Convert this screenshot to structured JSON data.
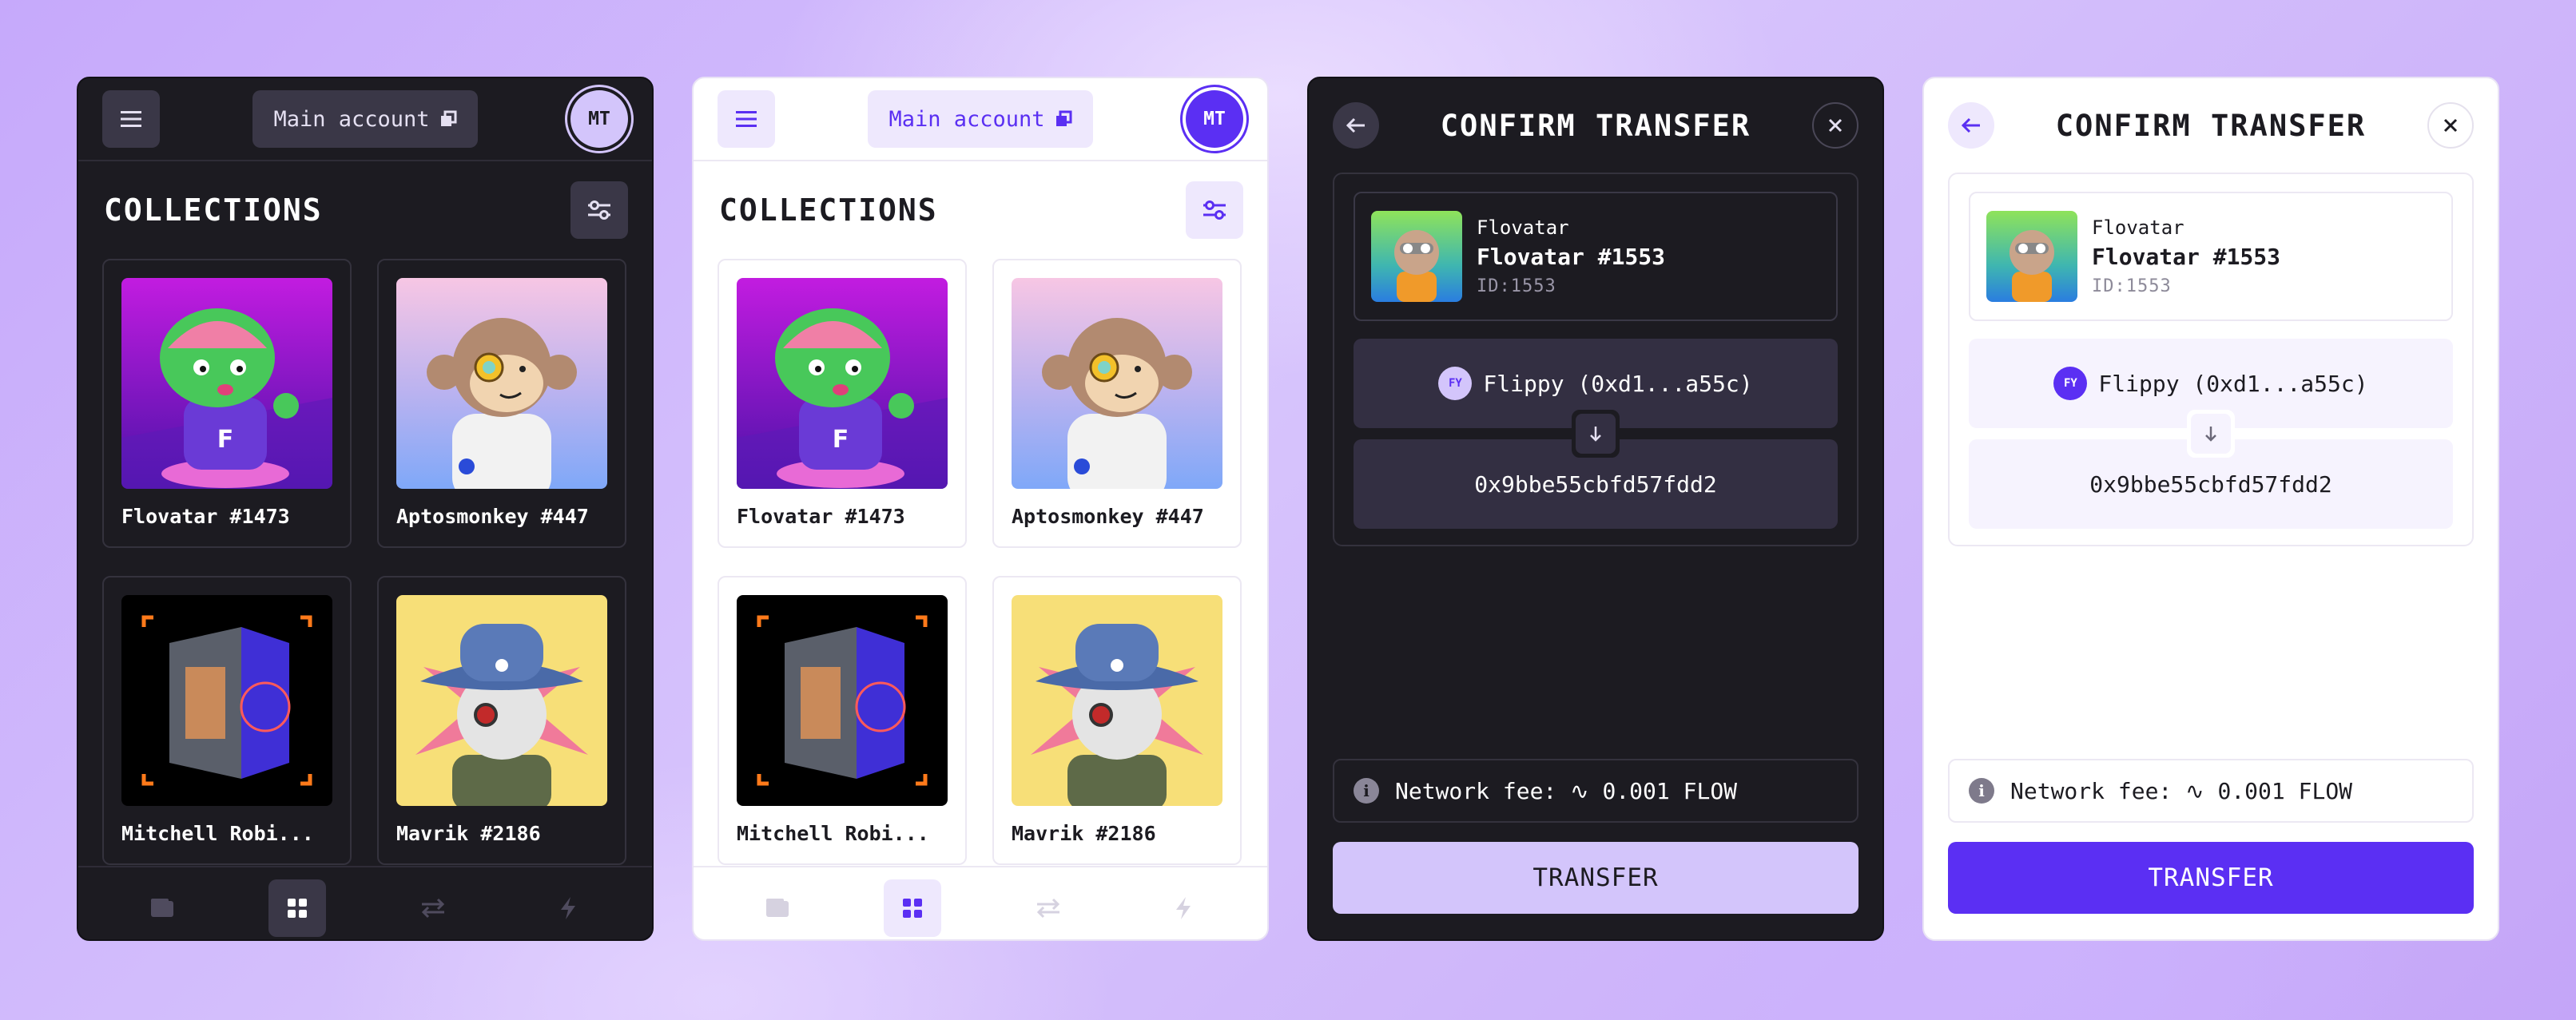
{
  "account": {
    "label": "Main account",
    "initials": "MT"
  },
  "collections": {
    "title": "COLLECTIONS",
    "items": [
      {
        "name": "Flovatar #1473"
      },
      {
        "name": "Aptosmonkey #447"
      },
      {
        "name": "Mitchell Robi..."
      },
      {
        "name": "Mavrik #2186"
      }
    ]
  },
  "nav": [
    "wallet-icon",
    "grid-icon",
    "transfer-icon",
    "bolt-icon"
  ],
  "transfer": {
    "title": "CONFIRM TRANSFER",
    "nft": {
      "collection": "Flovatar",
      "name": "Flovatar #1553",
      "id": "ID:1553"
    },
    "from": {
      "badge": "FY",
      "label": "Flippy (0xd1...a55c)"
    },
    "to": {
      "address": "0x9bbe55cbfd57fdd2"
    },
    "fee": "Network fee: ∿ 0.001 FLOW",
    "button": "TRANSFER"
  },
  "colors": {
    "accent": "#5b2ff3",
    "accent_light": "#d3c5fb",
    "dark_bg": "#1c1b21"
  }
}
